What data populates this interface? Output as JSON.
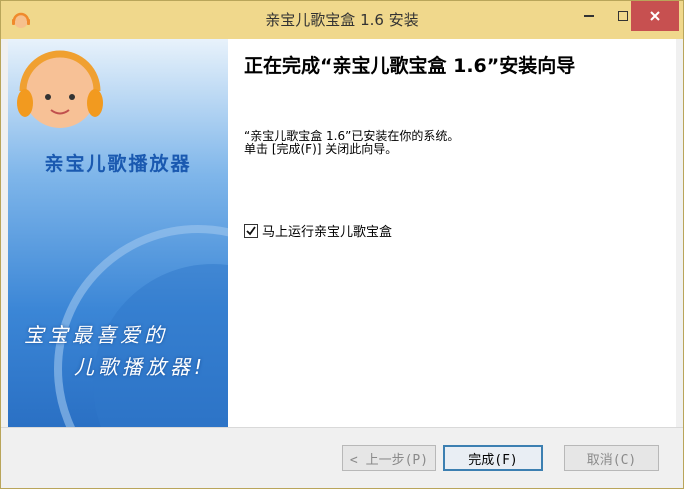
{
  "window": {
    "title": "亲宝儿歌宝盒 1.6 安装",
    "colors": {
      "titlebar": "#f0d88c",
      "close": "#c75050",
      "accent": "#3c7fb1"
    },
    "icons": {
      "app": "headphone-baby-icon",
      "minimize": "minimize-icon",
      "maximize": "maximize-icon",
      "close": "close-icon"
    }
  },
  "sidebar": {
    "brand": "亲宝儿歌播放器",
    "slogan_line1": "宝宝最喜爱的",
    "slogan_line2": "儿歌播放器!",
    "logo": "baby-face-headphones-logo"
  },
  "main": {
    "heading": "正在完成“亲宝儿歌宝盒 1.6”安装向导",
    "desc_line1": "“亲宝儿歌宝盒 1.6”已安装在你的系统。",
    "desc_line2": "单击 [完成(F)] 关闭此向导。",
    "run_checkbox": {
      "label": "马上运行亲宝儿歌宝盒",
      "checked": true
    }
  },
  "footer": {
    "back": "< 上一步(P)",
    "finish": "完成(F)",
    "cancel": "取消(C)"
  }
}
